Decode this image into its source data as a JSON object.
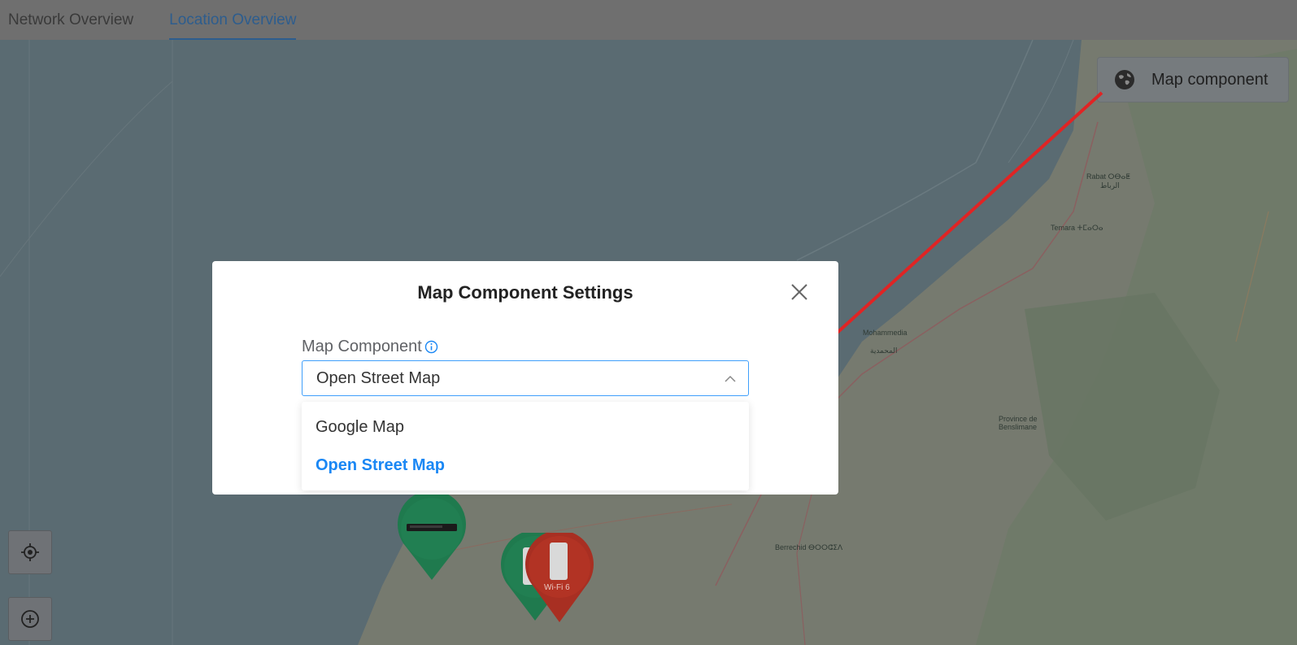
{
  "tabs": [
    {
      "label": "Network Overview",
      "active": false
    },
    {
      "label": "Location Overview",
      "active": true
    }
  ],
  "map_component_button": {
    "label": "Map component",
    "icon": "globe-icon"
  },
  "map_labels": [
    "Rabat ⵔⴱⴰⵟ",
    "الرباط",
    "Temara ⵜⵎⴰⵔⴰ",
    "Mohammedia",
    "المحمدية",
    "Berrechid ⴱⵔⵔⵛⵉⴷ",
    "Province de Benslimane",
    "Wi-Fi 6"
  ],
  "modal": {
    "title": "Map Component Settings",
    "field_label": "Map Component",
    "selected_value": "Open Street Map",
    "options": [
      {
        "label": "Google Map",
        "selected": false
      },
      {
        "label": "Open Street Map",
        "selected": true
      }
    ]
  },
  "colors": {
    "accent": "#1a87f4",
    "select_border": "#3f9ffb",
    "pin_green": "#1f7a4e",
    "pin_red": "#a82f22",
    "arrow": "#e02424"
  }
}
